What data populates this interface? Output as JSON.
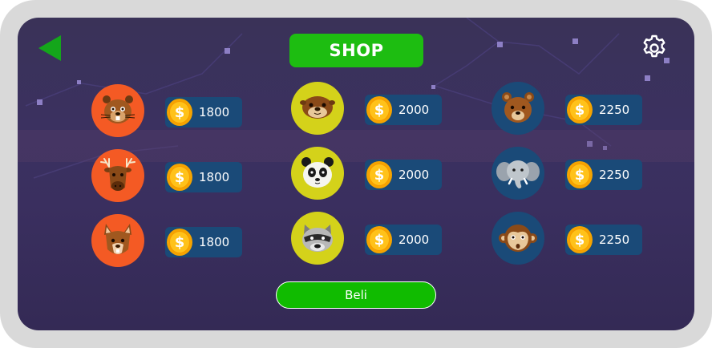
{
  "header": {
    "title": "SHOP",
    "back_icon": "back-arrow-icon",
    "settings_icon": "gear-icon"
  },
  "currency_icon": "coin-icon",
  "currency_symbol": "$",
  "colors": {
    "title_bg": "#1dbd11",
    "buy_bg": "#10bb00",
    "price_bg": "#1a4a78",
    "orange_circle": "#f45a24",
    "yellow_circle": "#d4d21a",
    "blue_circle": "#1a4a78"
  },
  "items": [
    {
      "animal": "beaver",
      "price": "1800"
    },
    {
      "animal": "moose",
      "price": "1800"
    },
    {
      "animal": "squirrel",
      "price": "1800"
    },
    {
      "animal": "otter",
      "price": "2000"
    },
    {
      "animal": "panda",
      "price": "2000"
    },
    {
      "animal": "raccoon",
      "price": "2000"
    },
    {
      "animal": "bear",
      "price": "2250"
    },
    {
      "animal": "elephant",
      "price": "2250"
    },
    {
      "animal": "monkey",
      "price": "2250"
    }
  ],
  "buy_button": {
    "label": "Beli"
  }
}
